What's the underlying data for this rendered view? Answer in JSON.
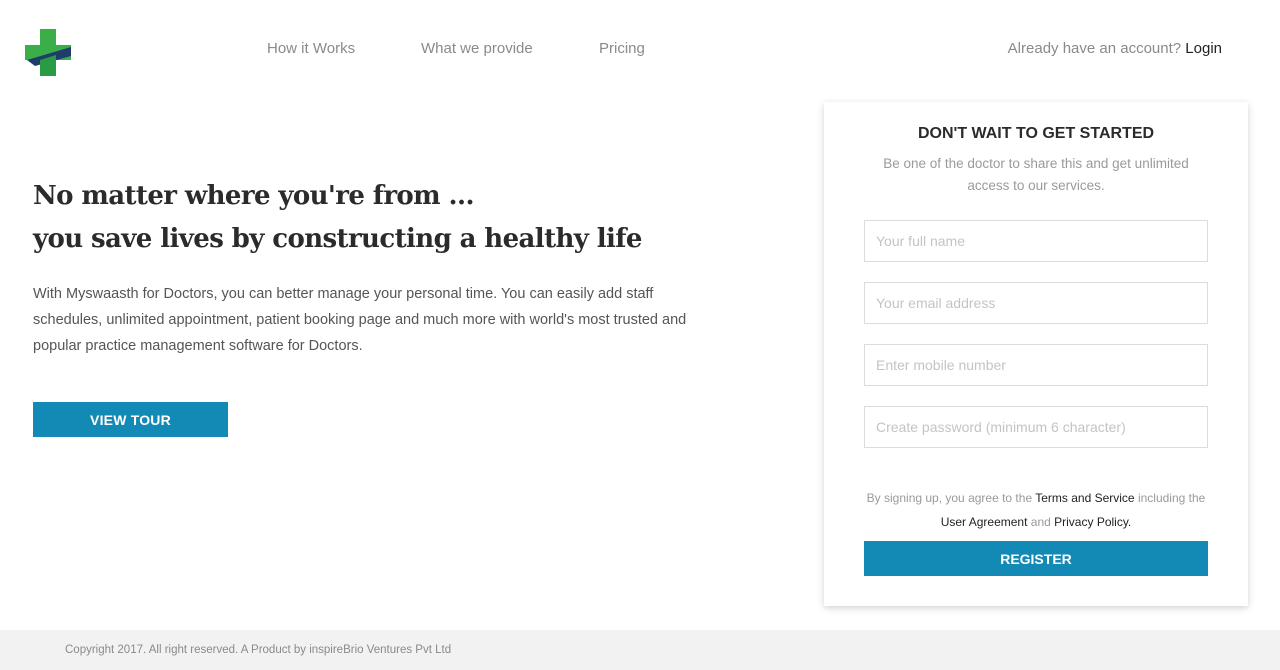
{
  "brand": {
    "logo_icon": "medical-cross-icon",
    "colors": {
      "green": "#3cae49",
      "navy": "#1e3d6b",
      "accent": "#138ab5"
    }
  },
  "nav": {
    "items": [
      {
        "label": "How it Works"
      },
      {
        "label": "What we provide"
      },
      {
        "label": "Pricing"
      }
    ]
  },
  "account": {
    "prompt": "Already have an account?",
    "login_label": "Login"
  },
  "hero": {
    "title_line1": "No matter where you're from ...",
    "title_line2": "you save lives by constructing a healthy life",
    "description": "With Myswaasth for Doctors, you can better manage your personal time. You can easily add staff schedules, unlimited appointment, patient booking page and much more with world's most trusted and popular practice management software for Doctors.",
    "tour_button": "VIEW TOUR"
  },
  "signup": {
    "title": "DON'T WAIT TO GET STARTED",
    "subtitle": "Be one of the doctor to share this and get unlimited access to our services.",
    "fields": [
      {
        "placeholder": "Your full name",
        "value": ""
      },
      {
        "placeholder": "Your email address",
        "value": ""
      },
      {
        "placeholder": "Enter mobile number",
        "value": ""
      },
      {
        "placeholder": "Create password (minimum 6 character)",
        "value": ""
      }
    ],
    "terms": {
      "prefix": "By signing up, you agree to the ",
      "terms_link": "Terms and Service",
      "middle": " including the ",
      "agreement_link": "User Agreement",
      "and": " and ",
      "privacy_link": "Privacy Policy."
    },
    "register_button": "REGISTER"
  },
  "footer": {
    "copyright": "Copyright 2017. All right reserved. A Product by inspireBrio Ventures Pvt Ltd"
  }
}
